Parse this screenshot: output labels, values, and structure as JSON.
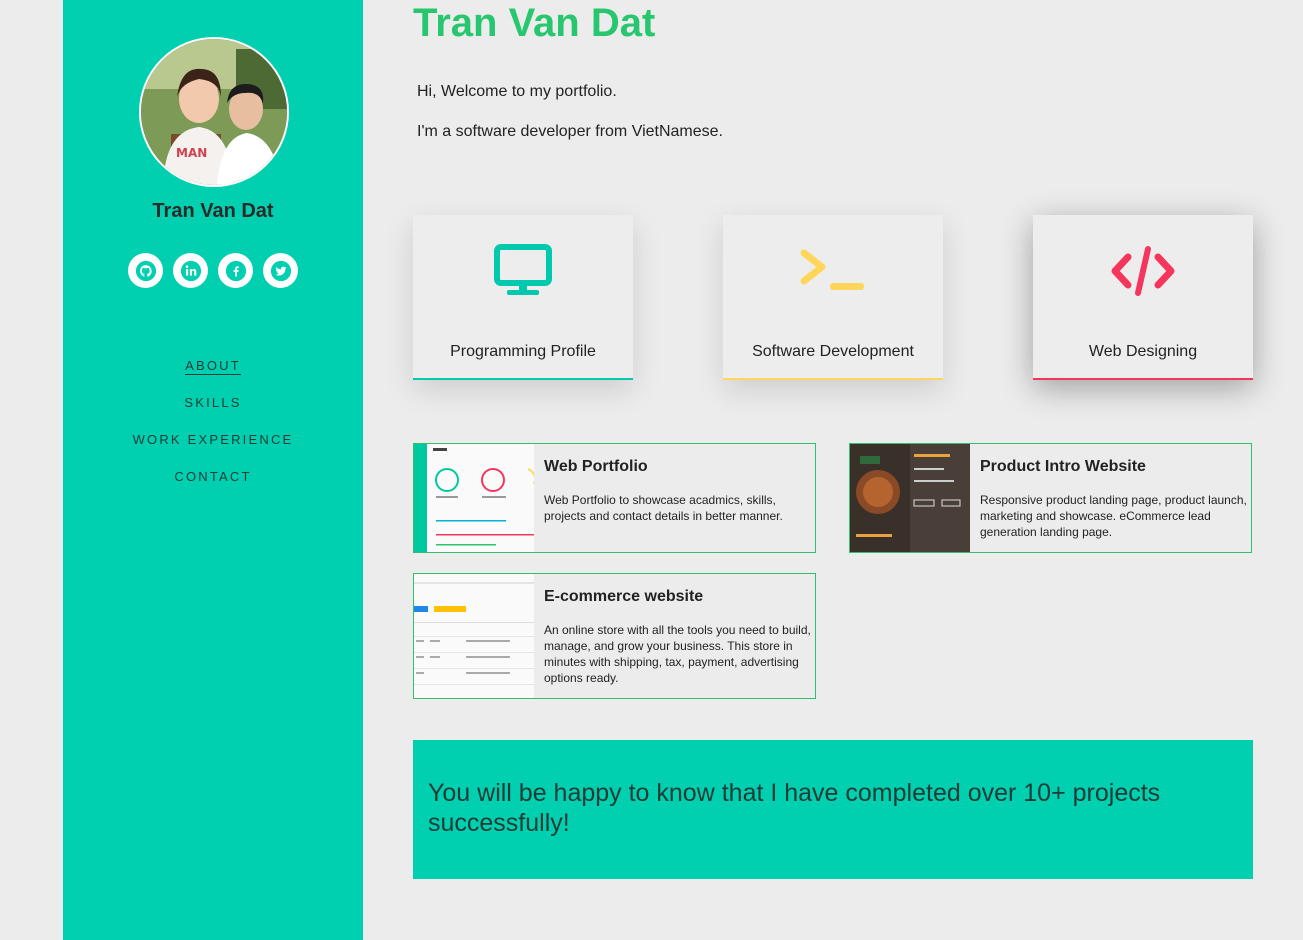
{
  "sidebar": {
    "name": "Tran Van Dat",
    "socials": [
      {
        "icon": "github-icon"
      },
      {
        "icon": "linkedin-icon"
      },
      {
        "icon": "facebook-icon"
      },
      {
        "icon": "twitter-icon"
      }
    ],
    "nav": [
      {
        "label": "ABOUT",
        "active": true
      },
      {
        "label": "SKILLS",
        "active": false
      },
      {
        "label": "WORK EXPERIENCE",
        "active": false
      },
      {
        "label": "CONTACT",
        "active": false
      }
    ]
  },
  "main": {
    "title": "Tran Van Dat",
    "intro": [
      "Hi, Welcome to my portfolio.",
      "I'm a software developer from VietNamese."
    ],
    "services": [
      {
        "label": "Programming Profile",
        "icon": "monitor-icon",
        "color": "#00c9ad"
      },
      {
        "label": "Software Development",
        "icon": "terminal-icon",
        "color": "#ffd65a"
      },
      {
        "label": "Web Designing",
        "icon": "code-icon",
        "color": "#f5365c"
      }
    ],
    "projects": [
      {
        "title": "Web Portfolio",
        "desc": "Web Portfolio to showcase acadmics, skills, projects and contact details in better manner."
      },
      {
        "title": "Product Intro Website",
        "desc": "Responsive product landing page, product launch, marketing and showcase. eCommerce lead generation landing page."
      },
      {
        "title": "E-commerce website",
        "desc": "An online store with all the tools you need to build, manage, and grow your business. This store in minutes with shipping, tax, payment, advertising options ready."
      }
    ],
    "banner": "You will be happy to know that I have completed over 10+ projects successfully!"
  },
  "colors": {
    "accent": "#00d0b0",
    "title": "#28c76f",
    "project_border": "#2fbf71"
  }
}
